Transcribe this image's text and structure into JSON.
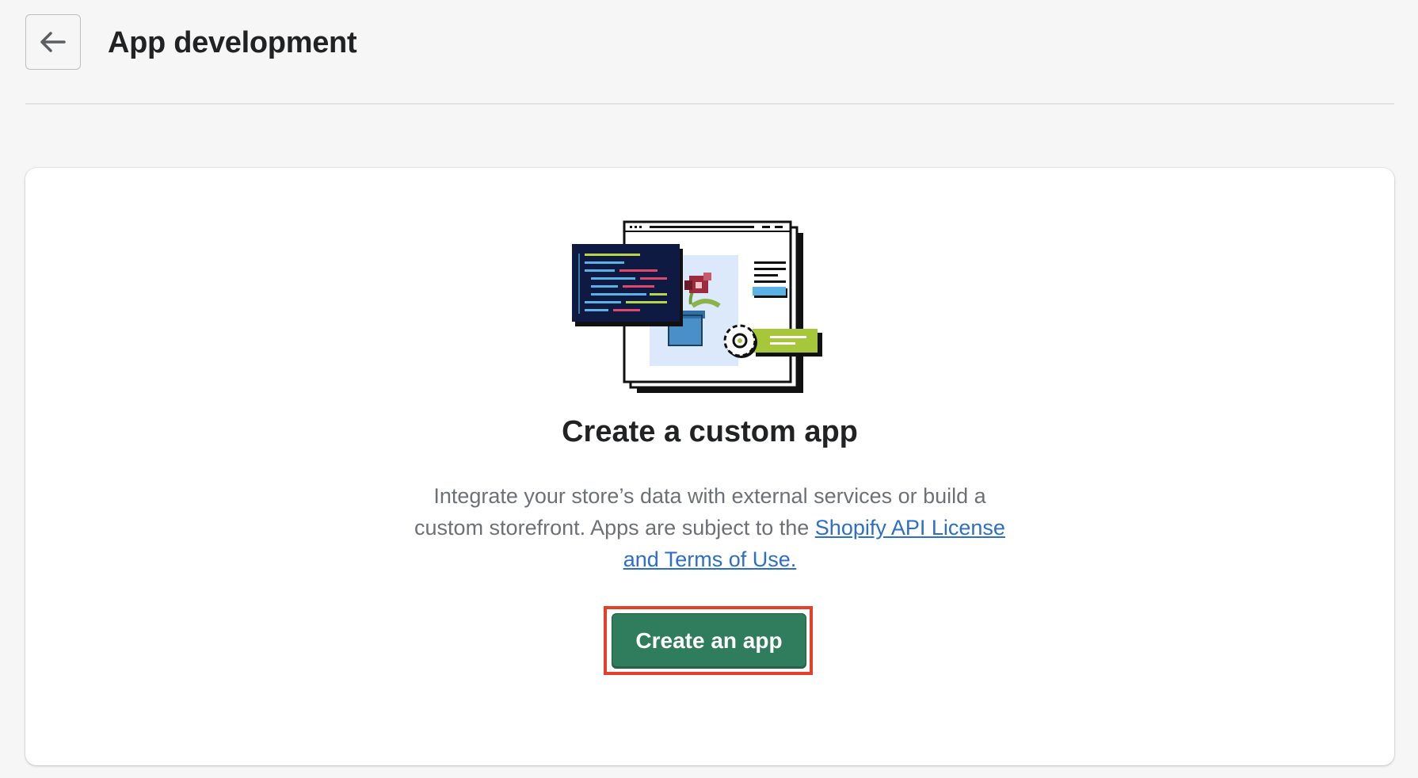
{
  "header": {
    "back_icon": "arrow-left-icon",
    "title": "App development"
  },
  "card": {
    "illustration": "custom-app-illustration",
    "heading": "Create a custom app",
    "description_text": "Integrate your store’s data with external services or build a custom storefront. Apps are subject to the ",
    "link_text": "Shopify API License and Terms of Use.",
    "button_label": "Create an app"
  },
  "colors": {
    "primary_button": "#2f7d5c",
    "link": "#2c6ecb",
    "highlight_box": "#e43f2b",
    "page_background": "#f6f6f7"
  }
}
